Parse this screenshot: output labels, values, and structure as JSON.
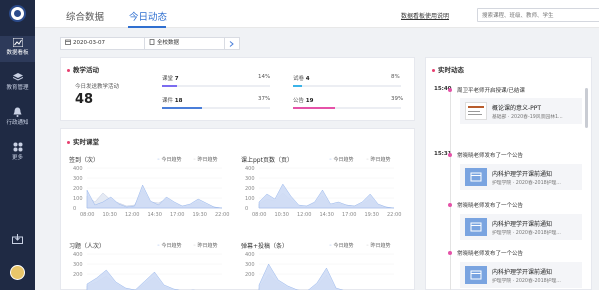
{
  "sidebar": {
    "items": [
      {
        "label": "数据看板",
        "icon": "chart-icon"
      },
      {
        "label": "教育管理",
        "icon": "layers-icon"
      },
      {
        "label": "行政通知",
        "icon": "bell-icon"
      },
      {
        "label": "更多",
        "icon": "grid-icon"
      }
    ]
  },
  "header": {
    "tabs": [
      "综合数据",
      "今日动态"
    ],
    "help_link": "数据看板使用说明",
    "search_placeholder": "搜索课程、班级、教师、学生"
  },
  "filter": {
    "date": "2020-03-07",
    "scope": "全校数据"
  },
  "teaching": {
    "title": "教学活动",
    "today_label": "今日发送教学活动",
    "today_count": "48",
    "items": [
      {
        "label": "课堂",
        "value": "7",
        "pct": "14%",
        "fraction": 0.14,
        "color": "#7b6cf0"
      },
      {
        "label": "试卷",
        "value": "4",
        "pct": "8%",
        "fraction": 0.08,
        "color": "#3bb3e8"
      },
      {
        "label": "课件",
        "value": "18",
        "pct": "37%",
        "fraction": 0.37,
        "color": "#4a7ed9"
      },
      {
        "label": "公告",
        "value": "19",
        "pct": "39%",
        "fraction": 0.39,
        "color": "#e552a8"
      }
    ]
  },
  "realtime": {
    "title": "实时课堂",
    "legend_today": "今日趋势",
    "legend_yesterday": "昨日趋势",
    "charts": [
      {
        "title": "签到（次）",
        "yticks": [
          "400",
          "300",
          "200",
          "100",
          "0"
        ]
      },
      {
        "title": "课上ppt页数（页）",
        "yticks": [
          "400",
          "300",
          "200",
          "100",
          "0"
        ]
      },
      {
        "title": "习题（人次）",
        "yticks": [
          "400",
          "300",
          "200"
        ]
      },
      {
        "title": "弹幕+投稿（条）",
        "yticks": [
          "400",
          "300",
          "200"
        ]
      }
    ],
    "xticks": [
      "08:00",
      "10:30",
      "12:00",
      "14:30",
      "17:00",
      "19:30",
      "22:00"
    ]
  },
  "chart_data": [
    {
      "type": "area",
      "title": "签到（次）",
      "x": [
        "08:00",
        "09:00",
        "10:00",
        "10:30",
        "11:00",
        "12:00",
        "13:00",
        "14:00",
        "14:30",
        "15:00",
        "16:00",
        "17:00",
        "18:00",
        "19:00",
        "19:30",
        "20:00",
        "21:00",
        "22:00"
      ],
      "series": [
        {
          "name": "今日趋势",
          "values": [
            180,
            30,
            60,
            110,
            40,
            10,
            20,
            230,
            70,
            30,
            110,
            60,
            20,
            40,
            90,
            50,
            10,
            0
          ]
        },
        {
          "name": "昨日趋势",
          "values": [
            120,
            60,
            150,
            80,
            50,
            20,
            30,
            180,
            60,
            50,
            90,
            40,
            20,
            30,
            60,
            30,
            10,
            0
          ]
        }
      ],
      "ylim": [
        0,
        400
      ]
    },
    {
      "type": "area",
      "title": "课上ppt页数（页）",
      "x": [
        "08:00",
        "09:00",
        "10:00",
        "10:30",
        "11:00",
        "12:00",
        "13:00",
        "14:00",
        "14:30",
        "15:00",
        "16:00",
        "17:00",
        "18:00",
        "19:00",
        "19:30",
        "20:00",
        "21:00",
        "22:00"
      ],
      "series": [
        {
          "name": "今日趋势",
          "values": [
            60,
            140,
            90,
            240,
            120,
            30,
            20,
            60,
            180,
            40,
            60,
            30,
            20,
            60,
            140,
            40,
            10,
            0
          ]
        },
        {
          "name": "昨日趋势",
          "values": [
            40,
            90,
            70,
            150,
            80,
            20,
            20,
            50,
            120,
            30,
            40,
            30,
            20,
            40,
            90,
            30,
            10,
            0
          ]
        }
      ],
      "ylim": [
        0,
        400
      ]
    },
    {
      "type": "area",
      "title": "习题（人次）",
      "x": [
        "08:00",
        "09:00",
        "10:00",
        "11:00",
        "12:00",
        "13:00",
        "14:00",
        "15:00",
        "16:00",
        "17:00",
        "18:00",
        "19:00",
        "20:00",
        "21:00",
        "22:00"
      ],
      "series": [
        {
          "name": "今日趋势",
          "values": [
            100,
            160,
            240,
            120,
            60,
            40,
            130,
            220,
            90,
            50,
            30,
            40,
            30,
            10,
            0
          ]
        },
        {
          "name": "昨日趋势",
          "values": [
            80,
            120,
            180,
            100,
            50,
            30,
            100,
            170,
            70,
            40,
            20,
            30,
            20,
            10,
            0
          ]
        }
      ],
      "ylim": [
        0,
        400
      ]
    },
    {
      "type": "area",
      "title": "弹幕+投稿（条）",
      "x": [
        "08:00",
        "09:00",
        "10:00",
        "11:00",
        "12:00",
        "13:00",
        "14:00",
        "15:00",
        "16:00",
        "17:00",
        "18:00",
        "19:00",
        "20:00",
        "21:00",
        "22:00"
      ],
      "series": [
        {
          "name": "今日趋势",
          "values": [
            90,
            300,
            140,
            80,
            40,
            30,
            110,
            260,
            60,
            30,
            20,
            30,
            20,
            10,
            0
          ]
        },
        {
          "name": "昨日趋势",
          "values": [
            60,
            200,
            110,
            60,
            30,
            20,
            80,
            190,
            50,
            20,
            20,
            20,
            10,
            10,
            0
          ]
        }
      ],
      "ylim": [
        0,
        400
      ]
    }
  ],
  "feed": {
    "title": "实时动态",
    "entries": [
      {
        "time": "15:40",
        "text": "周卫平老师开启授课/已结课",
        "card_title": "概论课的意义-PPT",
        "card_sub": "基础部 · 2020春-19风景园林1..."
      },
      {
        "time": "15:31",
        "text": "常晓晓老师发布了一个公告",
        "card_title": "内科护理学开课前通知",
        "card_sub": "护理学院 · 2020春-2018护理..."
      },
      {
        "time": "",
        "text": "常晓晓老师发布了一个公告",
        "card_title": "内科护理学开课前通知",
        "card_sub": "护理学院 · 2020春-2018护理..."
      },
      {
        "time": "",
        "text": "常晓晓老师发布了一个公告",
        "card_title": "内科护理学开课前通知",
        "card_sub": "护理学院 · 2020春-2018护理..."
      }
    ]
  }
}
